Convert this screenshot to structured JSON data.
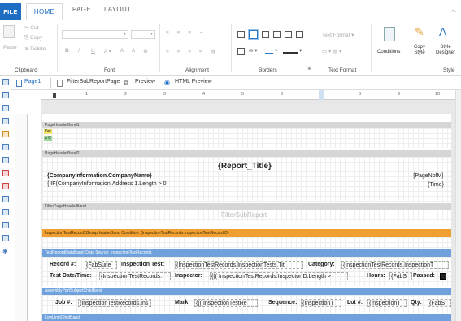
{
  "ribbon_tabs": {
    "file": "FILE",
    "home": "HOME",
    "page": "PAGE",
    "layout": "LAYOUT"
  },
  "clipboard": {
    "paste": "Paste",
    "cut": "Cut",
    "copy": "Copy",
    "delete": "Delete",
    "label": "Clipboard"
  },
  "font": {
    "label": "Font",
    "b": "B",
    "i": "I",
    "u": "U"
  },
  "alignment": {
    "label": "Alignment"
  },
  "borders": {
    "label": "Borders"
  },
  "text_format": {
    "combo": "Text Format",
    "label": "Text Format"
  },
  "style": {
    "conditions": "Conditions",
    "copy_style": "Copy Style",
    "style_designer": "Style Designer",
    "label": "Style"
  },
  "doc_tabs": [
    "Page1",
    "FilterSubReportPage",
    "Preview",
    "HTML Preview"
  ],
  "ruler_numbers": [
    "1",
    "2",
    "3",
    "4",
    "5",
    "6",
    "7",
    "8",
    "9",
    "10"
  ],
  "bands": {
    "page_header_1": "PageHeaderBand1",
    "page_header_1_det": "Det",
    "page_header_1_ac": "a C",
    "page_header_2": "PageHeaderBand2",
    "report_title": "{Report_Title}",
    "company_name": "{CompanyInformation.CompanyName}",
    "company_iif": "{IIF(CompanyInformation.Address 1.Length > 0,",
    "page_no": "{PageNofM}",
    "time": "{Time}",
    "filter_page_header": "FilterPageHeaderBand",
    "filter_sub_report": "FilterSubReport",
    "group_header": "InspectionTestRecord2GroupHeaderBand  Condition: {InspectionTestRecords.InspectionTestRecordID}",
    "data_band": "TestRecordDataBand; Data Source: InspectionTestRecords",
    "child_band": "AssemblyPartSubjectChildBand",
    "last_band": "LowLimitChildBand"
  },
  "row1": {
    "record_label": "Record #:",
    "record_value": "{FabSuite",
    "inspection_test_label": "Inspection Test:",
    "inspection_test_value": "{InspectionTestRecords.InspectionTests.Tit",
    "category_label": "Category:",
    "category_value": "{InspectionTestRecords.InspectionT"
  },
  "row2": {
    "date_label": "Test Date/Time:",
    "date_value": "{InspectionTestRecords.",
    "inspector_label": "Inspector:",
    "inspector_value": "{(( InspectionTestRecords.InspectorID.Length >",
    "hours_label": "Hours:",
    "hours_value": "{FabS",
    "passed_label": "Passed:"
  },
  "row3": {
    "job_label": "Job #:",
    "job_value": "{InspectionTestRecords.Ins",
    "mark_label": "Mark:",
    "mark_value": "{(( InspectionTestRe",
    "sequence_label": "Sequence:",
    "sequence_value": "{InspectionT",
    "lot_label": "Lot #:",
    "lot_value": "{InspectionT",
    "qty_label": "Qty:",
    "qty_value": "{FabS"
  },
  "colors": {
    "accent": "#1e6dc2",
    "orange_band": "#f0a033",
    "blue_band": "#6fa2dc"
  }
}
